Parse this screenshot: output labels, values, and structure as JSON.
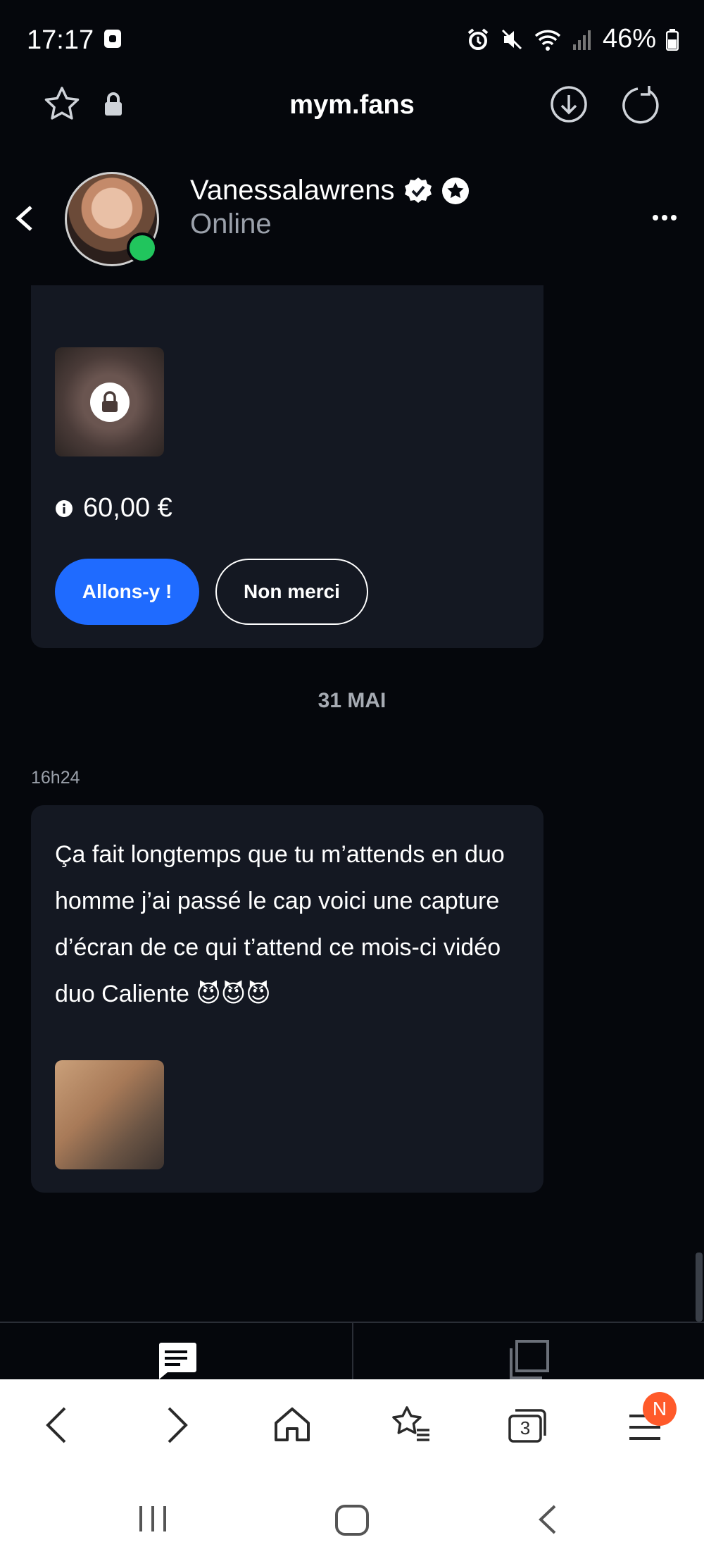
{
  "status_bar": {
    "time": "17:17",
    "battery": "46%"
  },
  "browser": {
    "url": "mym.fans"
  },
  "chat": {
    "contact_name": "Vanessalawrens",
    "contact_status": "Online",
    "offer": {
      "price": "60,00 €",
      "accept_label": "Allons-y !",
      "decline_label": "Non merci"
    },
    "date_separator": "31 MAI",
    "message": {
      "time": "16h24",
      "text": "Ça fait longtemps que tu m’attends en duo homme j’ai passé le cap voici une capture d’écran de ce qui t’attend ce mois-ci vidéo duo Caliente 😈😈😈"
    }
  },
  "browser_nav": {
    "tabs_count": "3",
    "menu_badge": "N"
  },
  "colors": {
    "accent": "#1f6bff",
    "online": "#21c55d",
    "badge": "#ff5a2a",
    "card": "#141822"
  }
}
